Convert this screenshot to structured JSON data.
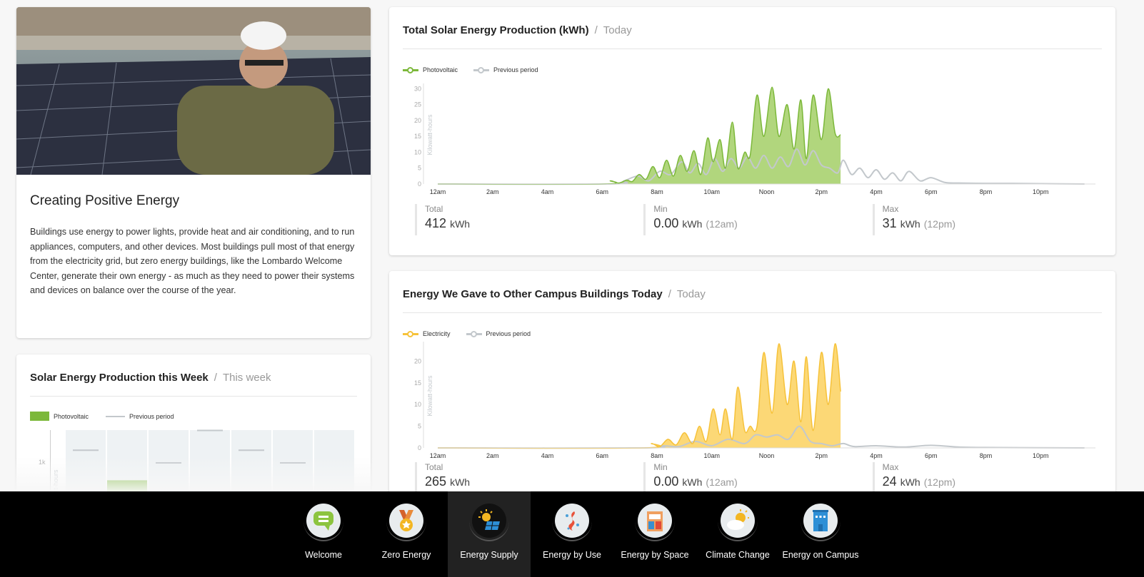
{
  "story": {
    "title": "Creating Positive Energy",
    "body": "Buildings use energy to power lights, provide heat and air conditioning, and to run appliances, computers, and other devices. Most buildings pull most of that energy from the electricity grid, but zero energy buildings, like the Lombardo Welcome Center, generate their own energy - as much as they need to power their systems and devices on balance over the course of the year."
  },
  "colors": {
    "pv": "#7cb83a",
    "pv_fill": "#b1d67d",
    "elec": "#f6c23a",
    "elec_fill": "#fcd876",
    "prev": "#c3c8cc",
    "nav_bg": "#000000"
  },
  "chart_data": [
    {
      "type": "area",
      "title": "Total Solar Energy Production (kWh)",
      "period": "Today",
      "ylabel": "Kilowatt-hours",
      "ylim": [
        0,
        31
      ],
      "yticks": [
        "0",
        "5",
        "10",
        "15",
        "20",
        "25",
        "30"
      ],
      "xticks": [
        "12am",
        "2am",
        "4am",
        "6am",
        "8am",
        "10am",
        "Noon",
        "2pm",
        "4pm",
        "6pm",
        "8pm",
        "10pm"
      ],
      "series": [
        {
          "name": "Photovoltaic",
          "x": [
            0,
            6,
            6.3,
            6.6,
            6.9,
            7.1,
            7.35,
            7.6,
            7.85,
            8.1,
            8.35,
            8.6,
            8.85,
            9.1,
            9.35,
            9.6,
            9.85,
            10.05,
            10.3,
            10.5,
            10.75,
            10.95,
            11.2,
            11.4,
            11.65,
            11.9,
            12.2,
            12.45,
            12.75,
            13.0,
            13.25,
            13.45,
            13.7,
            14.0,
            14.25,
            14.5,
            14.7
          ],
          "y": [
            0,
            0,
            1,
            0.3,
            1.2,
            0.8,
            3,
            1.5,
            5.5,
            2,
            7.5,
            2.5,
            9,
            4,
            10.5,
            3,
            14.5,
            7,
            14,
            5,
            19.5,
            5,
            10,
            9,
            28,
            15,
            30.5,
            15,
            25,
            11,
            26.5,
            8,
            28,
            14,
            30,
            16,
            15.5
          ]
        },
        {
          "name": "Previous period",
          "x": [
            0,
            6.3,
            6.8,
            7.3,
            7.7,
            8.1,
            8.5,
            8.9,
            9.2,
            9.5,
            9.8,
            10.1,
            10.4,
            10.7,
            11.0,
            11.3,
            11.6,
            11.9,
            12.2,
            12.5,
            12.8,
            13.1,
            13.4,
            13.7,
            14.0,
            14.3,
            14.6,
            14.8,
            15.1,
            15.4,
            15.7,
            16.0,
            16.3,
            16.6,
            16.9,
            17.2,
            17.6,
            18.0,
            18.5,
            19.0,
            20,
            21,
            22,
            23.6
          ],
          "y": [
            0,
            0,
            1,
            2.5,
            1,
            4,
            3,
            7,
            3.5,
            6.5,
            3,
            8,
            4,
            8,
            5,
            8.5,
            5,
            9,
            5,
            8.5,
            5.5,
            11,
            6,
            10.5,
            6,
            5,
            3.5,
            7.5,
            3,
            5,
            2,
            4.5,
            1.5,
            3.5,
            1,
            4,
            1,
            2,
            0.5,
            0.3,
            0.2,
            0.2,
            0.1,
            0
          ]
        }
      ],
      "stats": {
        "total_label": "Total",
        "total": "412",
        "total_unit": "kWh",
        "min_label": "Min",
        "min": "0.00",
        "min_unit": "kWh",
        "min_when": "(12am)",
        "max_label": "Max",
        "max": "31",
        "max_unit": "kWh",
        "max_when": "(12pm)"
      }
    },
    {
      "type": "area",
      "title": "Energy We Gave to Other Campus Buildings Today",
      "period": "Today",
      "ylabel": "Kilowatt-hours",
      "ylim": [
        0,
        24
      ],
      "yticks": [
        "0",
        "5",
        "10",
        "15",
        "20"
      ],
      "xticks": [
        "12am",
        "2am",
        "4am",
        "6am",
        "8am",
        "10am",
        "Noon",
        "2pm",
        "4pm",
        "6pm",
        "8pm",
        "10pm"
      ],
      "series": [
        {
          "name": "Electricity",
          "x": [
            0,
            7.5,
            7.8,
            8.1,
            8.4,
            8.7,
            9.0,
            9.3,
            9.55,
            9.8,
            10.05,
            10.3,
            10.5,
            10.75,
            10.95,
            11.2,
            11.4,
            11.65,
            11.9,
            12.2,
            12.45,
            12.75,
            13.0,
            13.25,
            13.45,
            13.7,
            14.0,
            14.25,
            14.5,
            14.7
          ],
          "y": [
            0,
            0,
            1,
            0.3,
            2,
            0.7,
            3.5,
            1,
            5,
            1.5,
            9,
            3,
            9,
            2,
            14,
            4,
            5,
            5,
            22,
            8,
            24,
            10,
            20,
            6,
            21,
            4,
            22,
            10,
            24,
            13
          ]
        },
        {
          "name": "Previous period",
          "x": [
            0,
            7.5,
            8.2,
            8.8,
            9.4,
            10.0,
            10.6,
            11.2,
            11.6,
            12.0,
            12.4,
            12.8,
            13.2,
            13.6,
            14.0,
            14.4,
            14.8,
            15.2,
            16.0,
            17.0,
            18.0,
            19,
            20,
            23.6
          ],
          "y": [
            0,
            0,
            0.5,
            0.3,
            1.5,
            0.5,
            2,
            1,
            3,
            2.5,
            3,
            2,
            5,
            1.5,
            1,
            0.5,
            1,
            0.3,
            0.5,
            0.2,
            0.6,
            0.2,
            0.1,
            0
          ]
        }
      ],
      "stats": {
        "total_label": "Total",
        "total": "265",
        "total_unit": "kWh",
        "min_label": "Min",
        "min": "0.00",
        "min_unit": "kWh",
        "min_when": "(12am)",
        "max_label": "Max",
        "max": "24",
        "max_unit": "kWh",
        "max_when": "(12pm)"
      }
    },
    {
      "type": "bar",
      "title": "Solar Energy Production this Week",
      "period": "This week",
      "ylabel": "Kilowatt-hours",
      "yticks": [
        "1k"
      ],
      "series": [
        {
          "name": "Photovoltaic",
          "values": [
            null,
            780,
            null,
            null,
            null,
            null,
            null
          ]
        },
        {
          "name": "Previous period",
          "values": [
            1160,
            null,
            1000,
            1410,
            1160,
            1000,
            650
          ]
        }
      ]
    }
  ],
  "nav": [
    {
      "label": "Welcome",
      "icon": "speech-bubble-icon"
    },
    {
      "label": "Zero Energy",
      "icon": "medal-icon"
    },
    {
      "label": "Energy Supply",
      "icon": "solar-panel-icon",
      "active": true
    },
    {
      "label": "Energy by Use",
      "icon": "flame-icon"
    },
    {
      "label": "Energy by Space",
      "icon": "building-rooms-icon"
    },
    {
      "label": "Climate Change",
      "icon": "sun-cloud-icon"
    },
    {
      "label": "Energy on Campus",
      "icon": "campus-building-icon"
    }
  ]
}
